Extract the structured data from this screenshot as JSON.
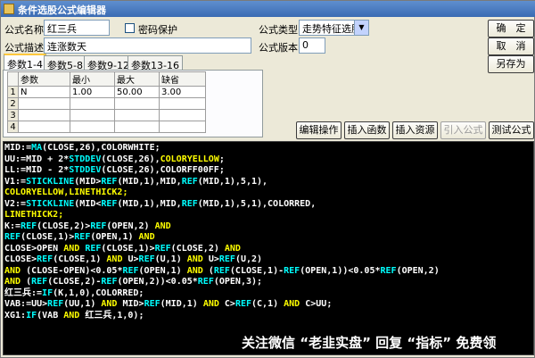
{
  "window": {
    "title": "条件选股公式编辑器"
  },
  "form": {
    "name_label": "公式名称",
    "name_value": "红三兵",
    "password_label": "密码保护",
    "type_label": "公式类型",
    "type_value": "走势特征选股",
    "desc_label": "公式描述",
    "desc_value": "连涨数天",
    "version_label": "公式版本",
    "version_value": "0"
  },
  "buttons": {
    "ok": "确　定",
    "cancel": "取　消",
    "save_as": "另存为",
    "edit_ops": "编辑操作",
    "insert_func": "插入函数",
    "insert_resource": "插入资源",
    "import_formula": "引入公式",
    "test_formula": "测试公式"
  },
  "tabs": [
    "参数1-4",
    "参数5-8",
    "参数9-12",
    "参数13-16"
  ],
  "params": {
    "headers": [
      "参数",
      "最小",
      "最大",
      "缺省"
    ],
    "rows": [
      {
        "num": "1",
        "name": "N",
        "min": "1.00",
        "max": "50.00",
        "default": "3.00"
      },
      {
        "num": "2",
        "name": "",
        "min": "",
        "max": "",
        "default": ""
      },
      {
        "num": "3",
        "name": "",
        "min": "",
        "max": "",
        "default": ""
      },
      {
        "num": "4",
        "name": "",
        "min": "",
        "max": "",
        "default": ""
      }
    ]
  },
  "code_lines": [
    [
      {
        "t": "MID:=",
        "c": "#ffffff"
      },
      {
        "t": "MA",
        "c": "#00ffff"
      },
      {
        "t": "(CLOSE,26),COLORWHITE;",
        "c": "#ffffff"
      }
    ],
    [
      {
        "t": "UU:=MID + 2*",
        "c": "#ffffff"
      },
      {
        "t": "STDDEV",
        "c": "#00ffff"
      },
      {
        "t": "(CLOSE,26),",
        "c": "#ffffff"
      },
      {
        "t": "COLORYELLOW",
        "c": "#ffff00"
      },
      {
        "t": ";",
        "c": "#ffffff"
      }
    ],
    [
      {
        "t": "LL:=MID - 2*",
        "c": "#ffffff"
      },
      {
        "t": "STDDEV",
        "c": "#00ffff"
      },
      {
        "t": "(CLOSE,26),COLORFF00FF;",
        "c": "#ffffff"
      }
    ],
    [
      {
        "t": "V1:=",
        "c": "#ffffff"
      },
      {
        "t": "STICKLINE",
        "c": "#00ffff"
      },
      {
        "t": "(MID>",
        "c": "#ffffff"
      },
      {
        "t": "REF",
        "c": "#00ffff"
      },
      {
        "t": "(MID,1),MID,",
        "c": "#ffffff"
      },
      {
        "t": "REF",
        "c": "#00ffff"
      },
      {
        "t": "(MID,1),5,1),",
        "c": "#ffffff"
      }
    ],
    [
      {
        "t": "COLORYELLOW,LINETHICK2;",
        "c": "#ffff00"
      }
    ],
    [
      {
        "t": "V2:=",
        "c": "#ffffff"
      },
      {
        "t": "STICKLINE",
        "c": "#00ffff"
      },
      {
        "t": "(MID<",
        "c": "#ffffff"
      },
      {
        "t": "REF",
        "c": "#00ffff"
      },
      {
        "t": "(MID,1),MID,",
        "c": "#ffffff"
      },
      {
        "t": "REF",
        "c": "#00ffff"
      },
      {
        "t": "(MID,1),5,1),COLORRED,",
        "c": "#ffffff"
      }
    ],
    [
      {
        "t": "LINETHICK2;",
        "c": "#ffff00"
      }
    ],
    [
      {
        "t": "K:=",
        "c": "#ffffff"
      },
      {
        "t": "REF",
        "c": "#00ffff"
      },
      {
        "t": "(CLOSE,2)>",
        "c": "#ffffff"
      },
      {
        "t": "REF",
        "c": "#00ffff"
      },
      {
        "t": "(OPEN,2) ",
        "c": "#ffffff"
      },
      {
        "t": "AND",
        "c": "#ffff00"
      }
    ],
    [
      {
        "t": "REF",
        "c": "#00ffff"
      },
      {
        "t": "(CLOSE,1)>",
        "c": "#ffffff"
      },
      {
        "t": "REF",
        "c": "#00ffff"
      },
      {
        "t": "(OPEN,1) ",
        "c": "#ffffff"
      },
      {
        "t": "AND",
        "c": "#ffff00"
      }
    ],
    [
      {
        "t": "CLOSE>OPEN ",
        "c": "#ffffff"
      },
      {
        "t": "AND ",
        "c": "#ffff00"
      },
      {
        "t": "REF",
        "c": "#00ffff"
      },
      {
        "t": "(CLOSE,1)>",
        "c": "#ffffff"
      },
      {
        "t": "REF",
        "c": "#00ffff"
      },
      {
        "t": "(CLOSE,2) ",
        "c": "#ffffff"
      },
      {
        "t": "AND",
        "c": "#ffff00"
      }
    ],
    [
      {
        "t": "CLOSE>",
        "c": "#ffffff"
      },
      {
        "t": "REF",
        "c": "#00ffff"
      },
      {
        "t": "(CLOSE,1) ",
        "c": "#ffffff"
      },
      {
        "t": "AND ",
        "c": "#ffff00"
      },
      {
        "t": "U>",
        "c": "#ffffff"
      },
      {
        "t": "REF",
        "c": "#00ffff"
      },
      {
        "t": "(U,1) ",
        "c": "#ffffff"
      },
      {
        "t": "AND ",
        "c": "#ffff00"
      },
      {
        "t": "U>",
        "c": "#ffffff"
      },
      {
        "t": "REF",
        "c": "#00ffff"
      },
      {
        "t": "(U,2)",
        "c": "#ffffff"
      }
    ],
    [
      {
        "t": "AND ",
        "c": "#ffff00"
      },
      {
        "t": "(CLOSE-OPEN)<0.05*",
        "c": "#ffffff"
      },
      {
        "t": "REF",
        "c": "#00ffff"
      },
      {
        "t": "(OPEN,1) ",
        "c": "#ffffff"
      },
      {
        "t": "AND ",
        "c": "#ffff00"
      },
      {
        "t": "(",
        "c": "#ffffff"
      },
      {
        "t": "REF",
        "c": "#00ffff"
      },
      {
        "t": "(CLOSE,1)-",
        "c": "#ffffff"
      },
      {
        "t": "REF",
        "c": "#00ffff"
      },
      {
        "t": "(OPEN,1))<0.05*",
        "c": "#ffffff"
      },
      {
        "t": "REF",
        "c": "#00ffff"
      },
      {
        "t": "(OPEN,2)",
        "c": "#ffffff"
      }
    ],
    [
      {
        "t": "AND ",
        "c": "#ffff00"
      },
      {
        "t": "(",
        "c": "#ffffff"
      },
      {
        "t": "REF",
        "c": "#00ffff"
      },
      {
        "t": "(CLOSE,2)-",
        "c": "#ffffff"
      },
      {
        "t": "REF",
        "c": "#00ffff"
      },
      {
        "t": "(OPEN,2))<0.05*",
        "c": "#ffffff"
      },
      {
        "t": "REF",
        "c": "#00ffff"
      },
      {
        "t": "(OPEN,3);",
        "c": "#ffffff"
      }
    ],
    [
      {
        "t": "红三兵:=",
        "c": "#ffffff"
      },
      {
        "t": "IF",
        "c": "#00ffff"
      },
      {
        "t": "(K,1,0),COLORRED;",
        "c": "#ffffff"
      }
    ],
    [
      {
        "t": "VAB:=UU>",
        "c": "#ffffff"
      },
      {
        "t": "REF",
        "c": "#00ffff"
      },
      {
        "t": "(UU,1) ",
        "c": "#ffffff"
      },
      {
        "t": "AND ",
        "c": "#ffff00"
      },
      {
        "t": "MID>",
        "c": "#ffffff"
      },
      {
        "t": "REF",
        "c": "#00ffff"
      },
      {
        "t": "(MID,1) ",
        "c": "#ffffff"
      },
      {
        "t": "AND ",
        "c": "#ffff00"
      },
      {
        "t": "C>",
        "c": "#ffffff"
      },
      {
        "t": "REF",
        "c": "#00ffff"
      },
      {
        "t": "(C,1) ",
        "c": "#ffffff"
      },
      {
        "t": "AND ",
        "c": "#ffff00"
      },
      {
        "t": "C>UU;",
        "c": "#ffffff"
      }
    ],
    [
      {
        "t": "XG1:",
        "c": "#ffffff"
      },
      {
        "t": "IF",
        "c": "#00ffff"
      },
      {
        "t": "(VAB ",
        "c": "#ffffff"
      },
      {
        "t": "AND ",
        "c": "#ffff00"
      },
      {
        "t": "红三兵,1,0);",
        "c": "#ffffff"
      }
    ]
  ],
  "watermark": "关注微信 “老韭实盘” 回复 “指标” 免费领"
}
